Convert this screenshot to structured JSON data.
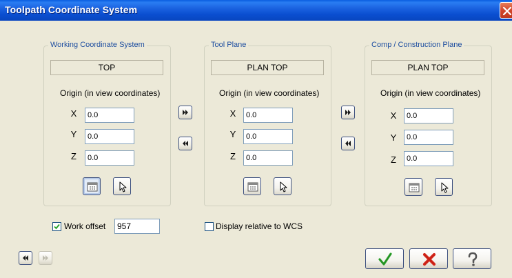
{
  "window": {
    "title": "Toolpath Coordinate System"
  },
  "wcs": {
    "legend": "Working Coordinate System",
    "plane": "TOP",
    "origin_label": "Origin (in view coordinates)",
    "x_label": "X",
    "y_label": "Y",
    "z_label": "Z",
    "x": "0.0",
    "y": "0.0",
    "z": "0.0"
  },
  "tool_plane": {
    "legend": "Tool Plane",
    "plane": "PLAN TOP",
    "origin_label": "Origin (in view coordinates)",
    "x_label": "X",
    "y_label": "Y",
    "z_label": "Z",
    "x": "0.0",
    "y": "0.0",
    "z": "0.0"
  },
  "comp_plane": {
    "legend": "Comp / Construction Plane",
    "plane": "PLAN TOP",
    "origin_label": "Origin (in view coordinates)",
    "x_label": "X",
    "y_label": "Y",
    "z_label": "Z",
    "x": "0.0",
    "y": "0.0",
    "z": "0.0"
  },
  "work_offset": {
    "label": "Work offset",
    "checked": true,
    "value": "957"
  },
  "display_relative": {
    "label": "Display relative to WCS",
    "checked": false
  },
  "colors": {
    "ok": "#2fa32f",
    "cancel": "#d8281c",
    "title_bar": "#0a4ed0"
  },
  "icons": {
    "close": "close-icon",
    "copy_right": "double-right-arrow-icon",
    "copy_left": "double-left-arrow-icon",
    "view_manager": "view-manager-icon",
    "select": "cursor-icon",
    "ok": "checkmark-icon",
    "cancel": "x-icon",
    "help": "question-icon"
  }
}
